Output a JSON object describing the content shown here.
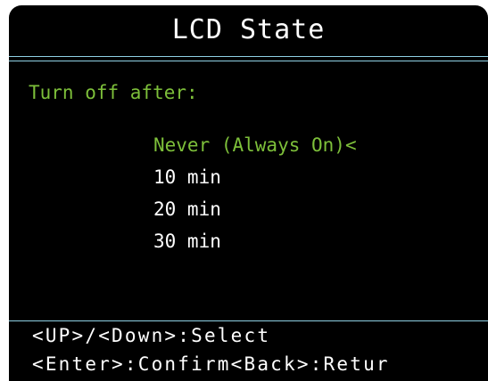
{
  "screen": {
    "title": "LCD State",
    "prompt": "Turn off after:",
    "options": [
      {
        "label": "Never (Always On)",
        "marker": "<",
        "selected": true
      },
      {
        "label": "10 min",
        "marker": "",
        "selected": false
      },
      {
        "label": "20 min",
        "marker": "",
        "selected": false
      },
      {
        "label": "30 min",
        "marker": "",
        "selected": false
      }
    ],
    "help_line_1": "<UP>/<Down>:Select",
    "help_line_2": "<Enter>:Confirm<Back>:Retur"
  },
  "colors": {
    "background": "#000000",
    "text": "#ffffff",
    "accent_green": "#7dbf3a",
    "divider_blue": "#8fd0e4"
  }
}
